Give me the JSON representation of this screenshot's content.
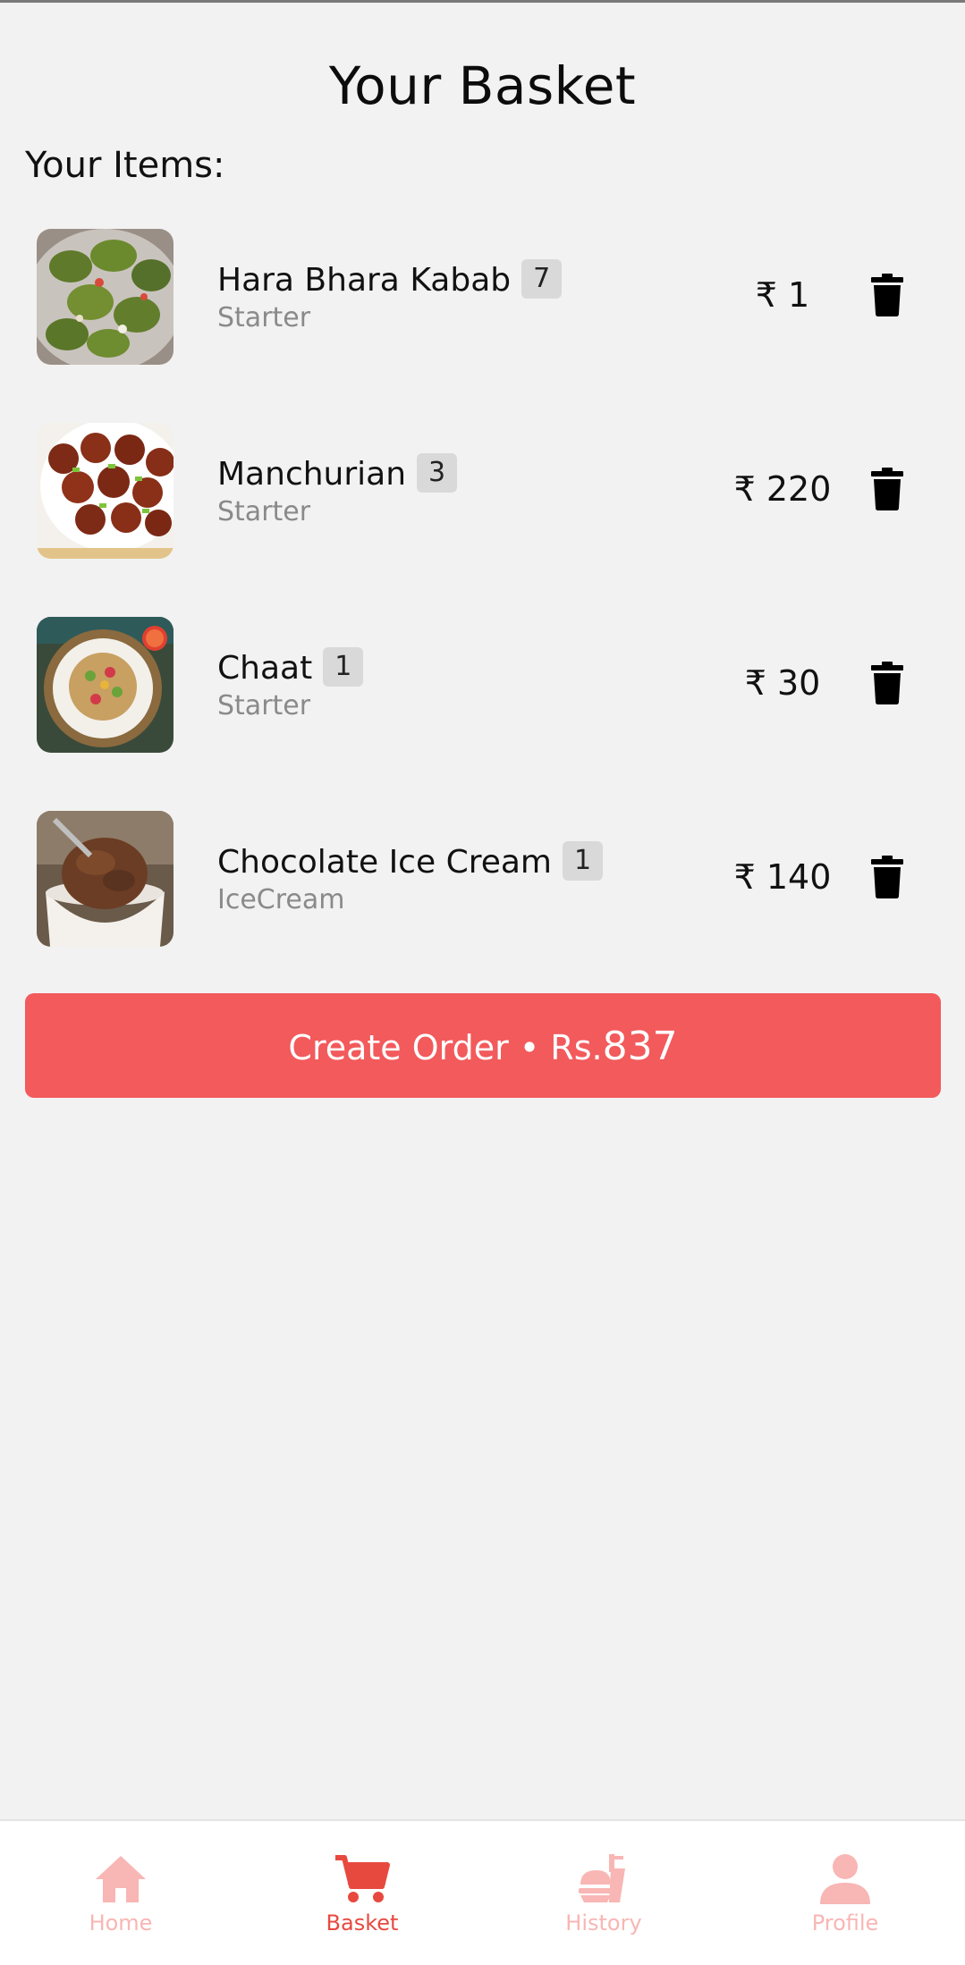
{
  "header": {
    "title": "Your Basket"
  },
  "items_label": "Your Items:",
  "items": [
    {
      "name": "Hara Bhara Kabab",
      "qty": "7",
      "category": "Starter",
      "price": "₹ 1",
      "image": "green-kabab-plate"
    },
    {
      "name": "Manchurian",
      "qty": "3",
      "category": "Starter",
      "price": "₹ 220",
      "image": "manchurian-balls-plate"
    },
    {
      "name": "Chaat",
      "qty": "1",
      "category": "Starter",
      "price": "₹ 30",
      "image": "chaat-plate"
    },
    {
      "name": "Chocolate Ice Cream",
      "qty": "1",
      "category": "IceCream",
      "price": "₹ 140",
      "image": "chocolate-ice-cream-bowl"
    }
  ],
  "order_button": {
    "label": "Create Order • Rs.",
    "total": "837"
  },
  "tabs": [
    {
      "label": "Home",
      "icon": "home-icon",
      "active": false
    },
    {
      "label": "Basket",
      "icon": "cart-icon",
      "active": true
    },
    {
      "label": "History",
      "icon": "history-icon",
      "active": false
    },
    {
      "label": "Profile",
      "icon": "profile-icon",
      "active": false
    }
  ],
  "colors": {
    "accent": "#f25a5c",
    "tab_active": "#e8493f",
    "tab_inactive": "#f8b6b4",
    "background": "#f2f2f2"
  }
}
